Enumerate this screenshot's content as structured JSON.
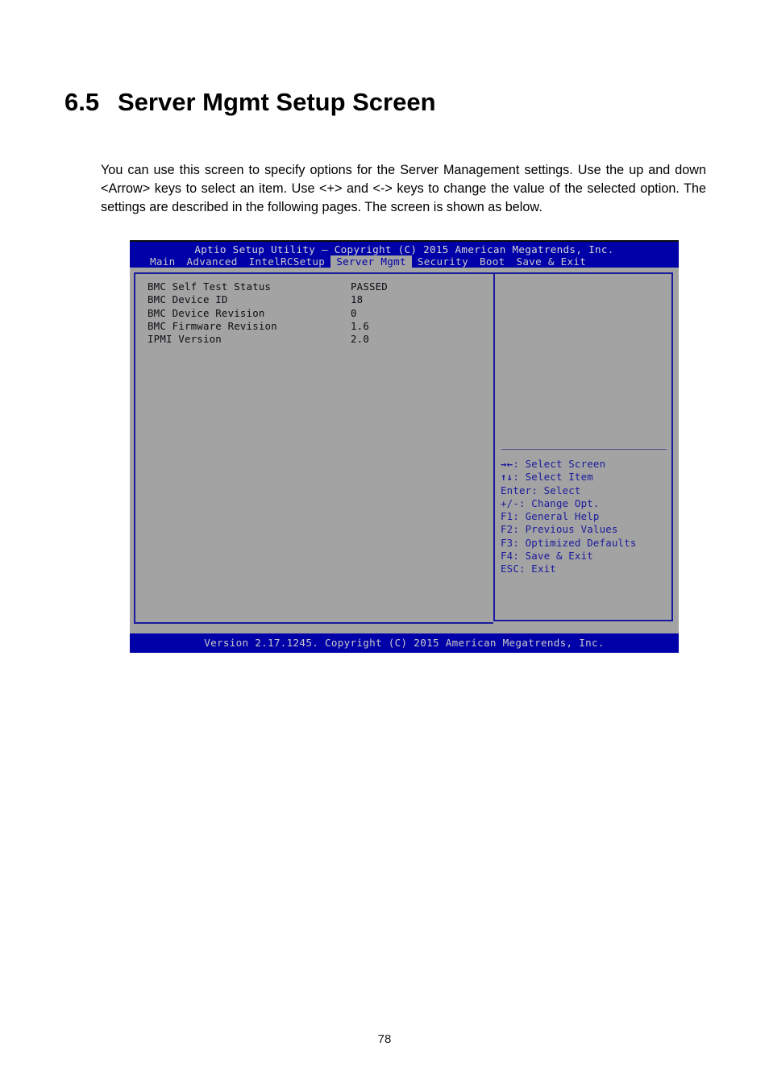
{
  "document": {
    "section_number": "6.5",
    "section_title": "Server Mgmt Setup Screen",
    "paragraph": "You can use this screen to specify options for the Server Management settings. Use the up and down <Arrow> keys to select an item. Use <+> and <-> keys to change the value of the selected option. The settings are described in the following pages. The screen is shown as below.",
    "page_number": "78"
  },
  "bios": {
    "title": "Aptio Setup Utility – Copyright (C) 2015 American Megatrends, Inc.",
    "footer": "Version 2.17.1245. Copyright (C) 2015 American Megatrends, Inc.",
    "menu_tabs": [
      {
        "label": "Main",
        "active": false
      },
      {
        "label": "Advanced",
        "active": false
      },
      {
        "label": "IntelRCSetup",
        "active": false
      },
      {
        "label": "Server Mgmt",
        "active": true
      },
      {
        "label": "Security",
        "active": false
      },
      {
        "label": "Boot",
        "active": false
      },
      {
        "label": "Save & Exit",
        "active": false
      }
    ],
    "settings": [
      {
        "label": "BMC Self Test Status",
        "value": "PASSED"
      },
      {
        "label": "BMC Device ID",
        "value": "18"
      },
      {
        "label": "BMC Device Revision",
        "value": "0"
      },
      {
        "label": "BMC Firmware Revision",
        "value": "1.6"
      },
      {
        "label": "IPMI Version",
        "value": "2.0"
      }
    ],
    "help_legend": [
      {
        "key": "→←",
        "text": ": Select Screen"
      },
      {
        "key": "↑↓",
        "text": ": Select Item"
      },
      {
        "key": "Enter",
        "text": ": Select"
      },
      {
        "key": "+/-",
        "text": ": Change Opt."
      },
      {
        "key": "F1",
        "text": ": General Help"
      },
      {
        "key": "F2",
        "text": ": Previous Values"
      },
      {
        "key": "F3",
        "text": ": Optimized Defaults"
      },
      {
        "key": "F4",
        "text": ": Save & Exit"
      },
      {
        "key": "ESC",
        "text": ": Exit"
      }
    ],
    "colors": {
      "band_blue": "#0000a8",
      "panel_gray": "#a3a3a3",
      "border_blue": "#1a1a9c",
      "band_text": "#c9c9c9"
    }
  }
}
